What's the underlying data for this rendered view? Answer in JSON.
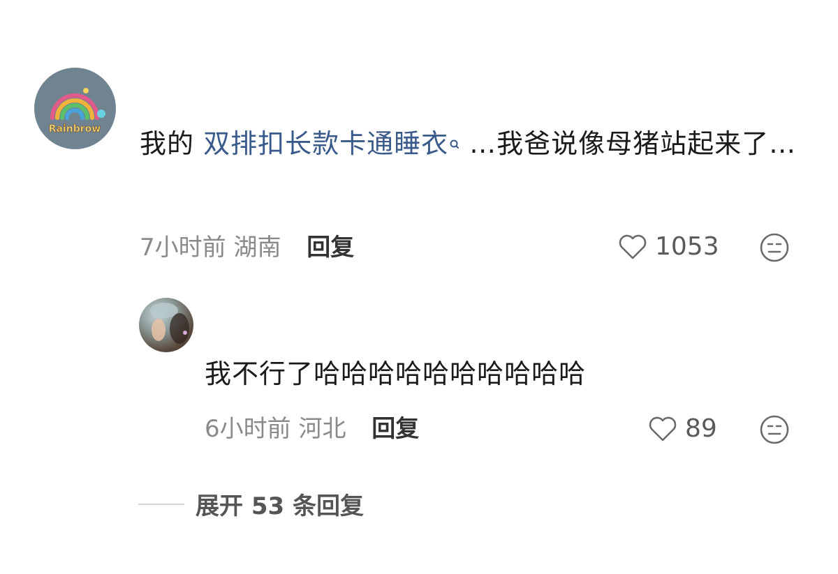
{
  "main_comment": {
    "avatar_label": "Rainbrow",
    "text_prefix": "我的 ",
    "link_text": "双排扣长款卡通睡衣",
    "text_suffix": "…我爸说像母猪站起来了…",
    "time": "7小时前",
    "location": "湖南",
    "reply_label": "回复",
    "likes": "1053"
  },
  "reply_comment": {
    "text": "我不行了哈哈哈哈哈哈哈哈哈哈",
    "time": "6小时前",
    "location": "河北",
    "reply_label": "回复",
    "likes": "89"
  },
  "expand": {
    "label": "展开 53 条回复"
  },
  "icons": {
    "like": "heart-outline-icon",
    "emoji": "neutral-face-icon",
    "search": "search-icon"
  },
  "colors": {
    "link": "#3a5a8c",
    "meta": "#8a8a8a"
  }
}
